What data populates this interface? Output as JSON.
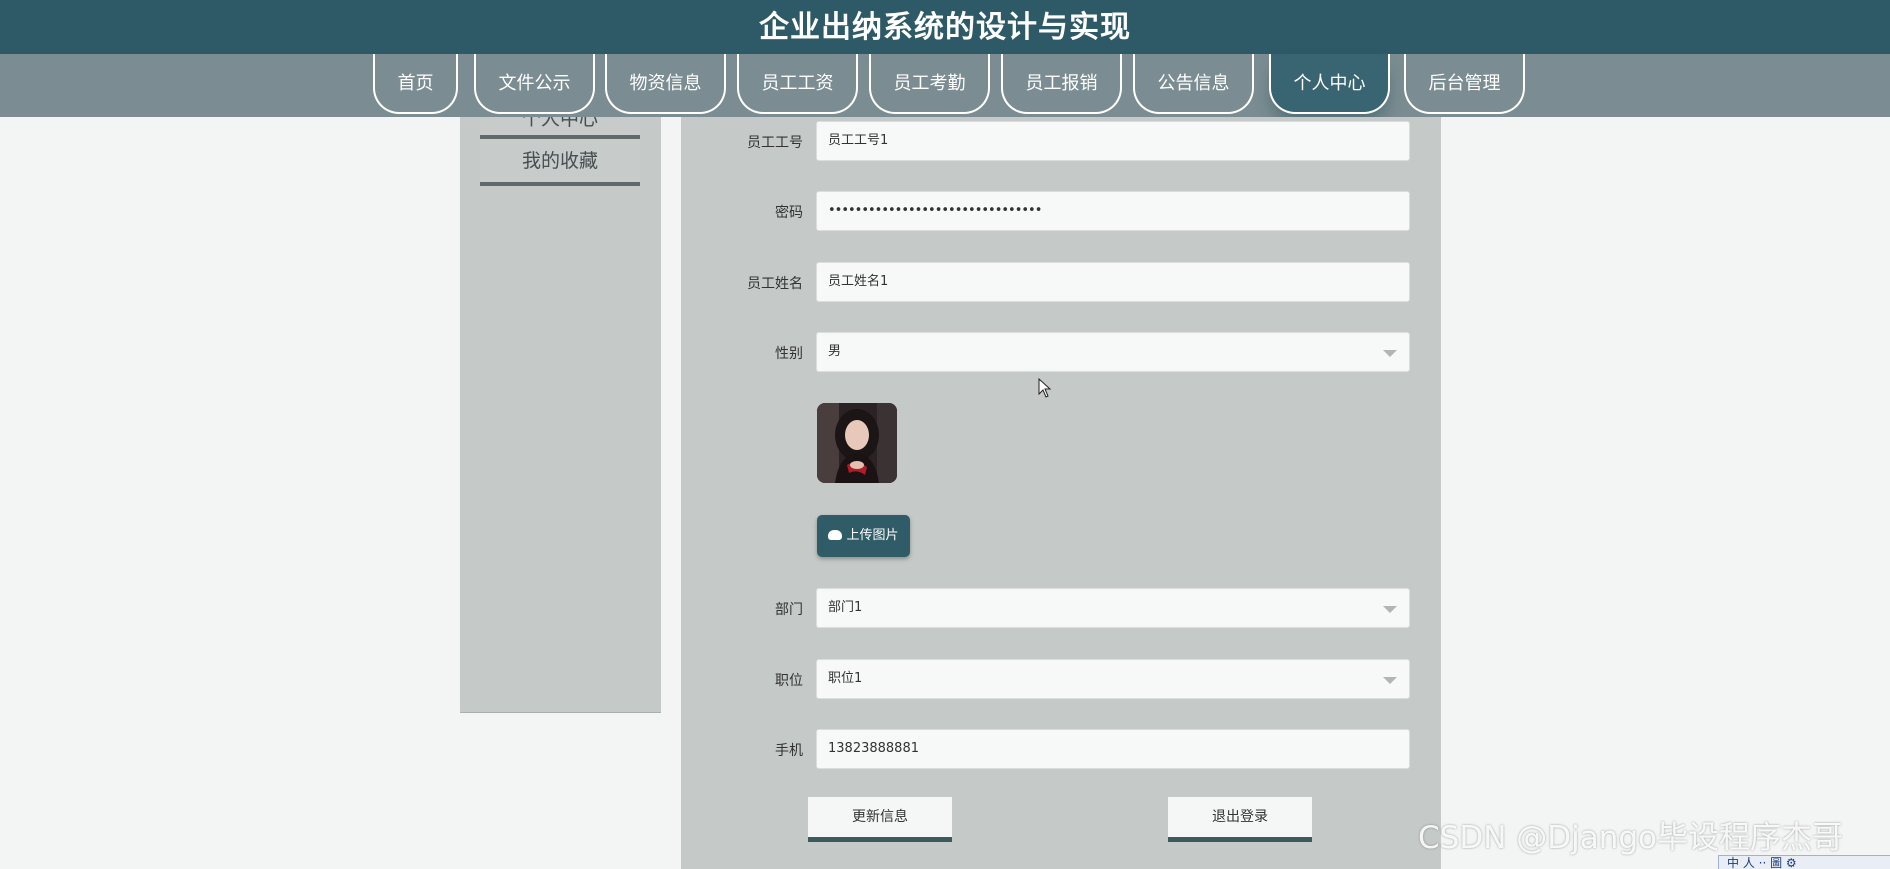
{
  "header": {
    "title": "企业出纳系统的设计与实现"
  },
  "nav": {
    "items": [
      {
        "label": "首页"
      },
      {
        "label": "文件公示"
      },
      {
        "label": "物资信息"
      },
      {
        "label": "员工工资"
      },
      {
        "label": "员工考勤"
      },
      {
        "label": "员工报销"
      },
      {
        "label": "公告信息"
      },
      {
        "label": "个人中心",
        "active": true
      },
      {
        "label": "后台管理"
      }
    ],
    "active_color": "#386571"
  },
  "sidebar": {
    "items": [
      {
        "label": "个人中心"
      },
      {
        "label": "我的收藏"
      }
    ]
  },
  "form": {
    "employee_id": {
      "label": "员工工号",
      "value": "员工工号1"
    },
    "password": {
      "label": "密码",
      "value": "••••••••••••••••••••••••••••••••"
    },
    "name": {
      "label": "员工姓名",
      "value": "员工姓名1"
    },
    "gender": {
      "label": "性别",
      "value": "男"
    },
    "upload_label": "上传图片",
    "department": {
      "label": "部门",
      "value": "部门1"
    },
    "position": {
      "label": "职位",
      "value": "职位1"
    },
    "phone": {
      "label": "手机",
      "value": "13823888881"
    },
    "update_label": "更新信息",
    "logout_label": "退出登录"
  },
  "colors": {
    "header": "#2d5a66",
    "nav": "#7b8d92",
    "panel": "#c5c9c8",
    "button_border": "#3b5c58"
  },
  "watermark": "CSDN @Django毕设程序杰哥",
  "taskbar": {
    "text": "中 人 ·· 圖 ⚙"
  }
}
